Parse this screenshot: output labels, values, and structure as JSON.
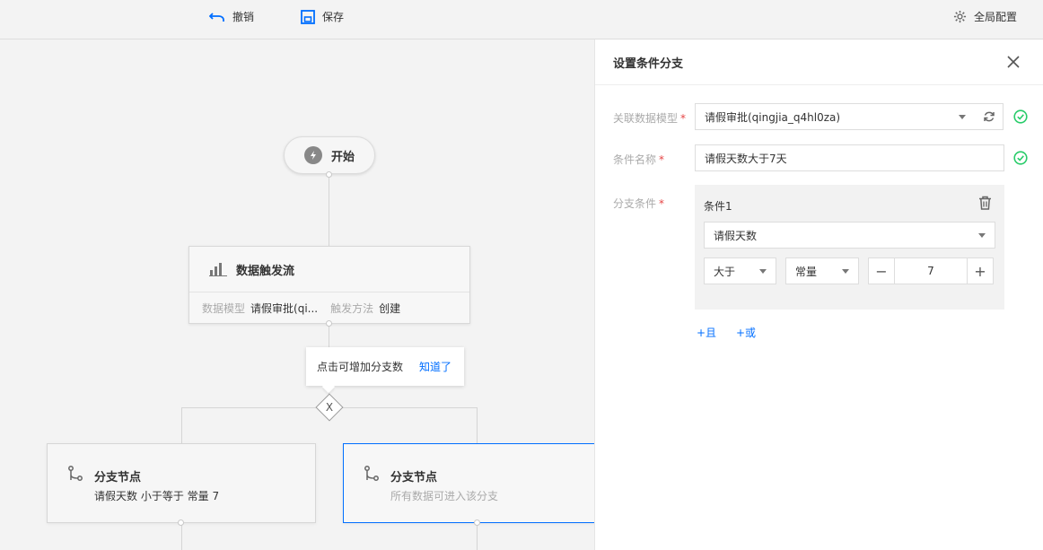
{
  "toolbar": {
    "undo_label": "撤销",
    "save_label": "保存",
    "global_label": "全局配置"
  },
  "canvas": {
    "start_label": "开始",
    "trigger": {
      "title": "数据触发流",
      "model_key": "数据模型",
      "model_value": "请假审批(qi...",
      "method_key": "触发方法",
      "method_value": "创建"
    },
    "tip": {
      "text": "点击可增加分支数",
      "link": "知道了"
    },
    "gateway_symbol": "X",
    "branches": [
      {
        "title": "分支节点",
        "desc": "请假天数 小于等于 常量 7"
      },
      {
        "title": "分支节点",
        "desc": "所有数据可进入该分支"
      }
    ]
  },
  "panel": {
    "title": "设置条件分支",
    "model_label": "关联数据模型",
    "model_value": "请假审批(qingjia_q4hl0za)",
    "name_label": "条件名称",
    "name_value": "请假天数大于7天",
    "branch_label": "分支条件",
    "required_mark": "*",
    "condition": {
      "title": "条件1",
      "field": "请假天数",
      "operator": "大于",
      "value_type": "常量",
      "value": "7",
      "minus": "−",
      "plus": "+"
    },
    "add_and": "+且",
    "add_or": "+或"
  },
  "colors": {
    "accent": "#006eff",
    "success": "#29cc6a",
    "required": "#e54545"
  }
}
